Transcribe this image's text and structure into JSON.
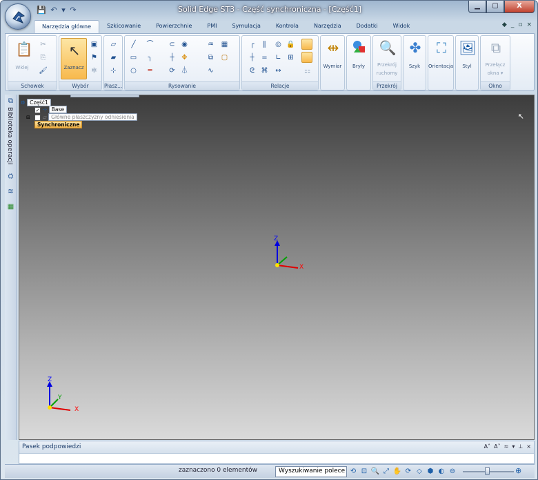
{
  "window": {
    "title": "Solid Edge ST3 - Część synchroniczna - [Część1]",
    "min_label": "▁",
    "max_label": "▢",
    "close_label": "X"
  },
  "ribbon_tabs": [
    "Narzędzia główne",
    "Szkicowanie",
    "Powierzchnie",
    "PMI",
    "Symulacja",
    "Kontrola",
    "Narzędzia",
    "Dodatki",
    "Widok"
  ],
  "groups": {
    "schowek": {
      "label": "Schowek",
      "paste": "Wklej"
    },
    "wybor": {
      "label": "Wybór",
      "select": "Zaznacz"
    },
    "plasz": {
      "label": "Płasz..."
    },
    "rysowanie": {
      "label": "Rysowanie"
    },
    "relacje": {
      "label": "Relacje"
    },
    "wymiar": {
      "label": "Wymiar"
    },
    "bryly": {
      "label": "Bryły"
    },
    "przekroj": {
      "label": "Przekrój",
      "moving1": "Przekrój",
      "moving2": "ruchomy"
    },
    "szyk": {
      "label": "Szyk"
    },
    "orientacja": {
      "label": "Orientacja"
    },
    "styl": {
      "label": "Styl"
    },
    "okno": {
      "label": "Okno",
      "switch1": "Przełącz",
      "switch2": "okna ▾"
    }
  },
  "side_panel": {
    "label": "Biblioteka operacji"
  },
  "tree": {
    "root": "Część1",
    "items": [
      {
        "label": "Base",
        "checked": true
      },
      {
        "label": "Główne płaszczyzny odniesienia",
        "checked": false
      },
      {
        "label": "Synchroniczne",
        "selected": true
      }
    ]
  },
  "axes": {
    "x": "X",
    "y": "Y",
    "z": "Z"
  },
  "hint_panel": {
    "title": "Pasek podpowiedzi"
  },
  "status": {
    "selection": "zaznaczono 0 elementów",
    "search_placeholder": "Wyszukiwanie polece"
  }
}
